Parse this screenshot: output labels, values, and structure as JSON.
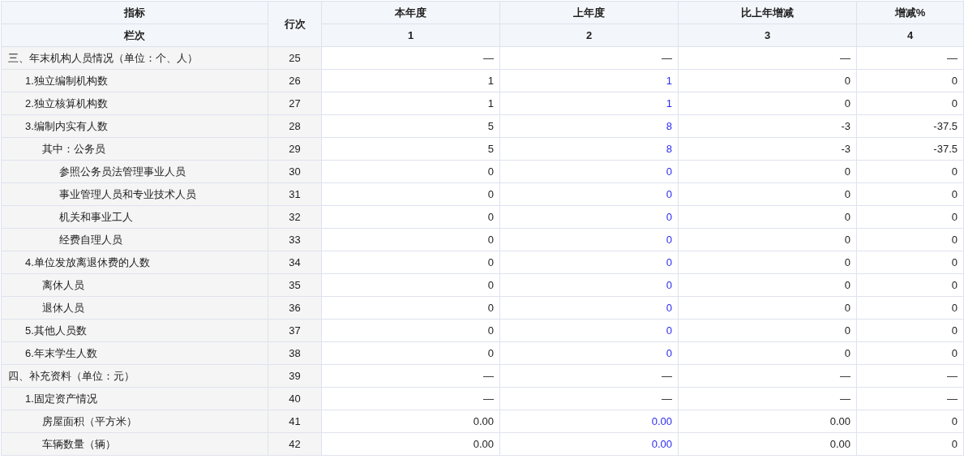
{
  "header": {
    "indicator": "指标",
    "column_label": "栏次",
    "line_no": "行次",
    "columns": [
      {
        "title": "本年度",
        "number": "1"
      },
      {
        "title": "上年度",
        "number": "2"
      },
      {
        "title": "比上年增减",
        "number": "3"
      },
      {
        "title": "增减%",
        "number": "4"
      }
    ]
  },
  "rows": [
    {
      "kind": "heading",
      "label": "三、年末机构人员情况（单位：个、人）",
      "line": "25",
      "values": [
        "—",
        "—",
        "—",
        "—"
      ],
      "children": [
        {
          "kind": "data",
          "label": "1.独立编制机构数",
          "line": "26",
          "values": [
            "1",
            "1",
            "0",
            "0"
          ]
        },
        {
          "kind": "data",
          "label": "2.独立核算机构数",
          "line": "27",
          "values": [
            "1",
            "1",
            "0",
            "0"
          ]
        },
        {
          "kind": "data",
          "label": "3.编制内实有人数",
          "line": "28",
          "values": [
            "5",
            "8",
            "-3",
            "-37.5"
          ],
          "children": [
            {
              "kind": "data",
              "label": "其中：公务员",
              "line": "29",
              "values": [
                "5",
                "8",
                "-3",
                "-37.5"
              ],
              "children": [
                {
                  "kind": "data",
                  "label": "参照公务员法管理事业人员",
                  "line": "30",
                  "values": [
                    "0",
                    "0",
                    "0",
                    "0"
                  ]
                },
                {
                  "kind": "data",
                  "label": "事业管理人员和专业技术人员",
                  "line": "31",
                  "values": [
                    "0",
                    "0",
                    "0",
                    "0"
                  ]
                },
                {
                  "kind": "data",
                  "label": "机关和事业工人",
                  "line": "32",
                  "values": [
                    "0",
                    "0",
                    "0",
                    "0"
                  ]
                },
                {
                  "kind": "data",
                  "label": "经费自理人员",
                  "line": "33",
                  "values": [
                    "0",
                    "0",
                    "0",
                    "0"
                  ]
                }
              ]
            }
          ]
        },
        {
          "kind": "data",
          "label": "4.单位发放离退休费的人数",
          "line": "34",
          "values": [
            "0",
            "0",
            "0",
            "0"
          ],
          "children": [
            {
              "kind": "data",
              "label": "离休人员",
              "line": "35",
              "values": [
                "0",
                "0",
                "0",
                "0"
              ]
            },
            {
              "kind": "data",
              "label": "退休人员",
              "line": "36",
              "values": [
                "0",
                "0",
                "0",
                "0"
              ]
            }
          ]
        },
        {
          "kind": "data",
          "label": "5.其他人员数",
          "line": "37",
          "values": [
            "0",
            "0",
            "0",
            "0"
          ]
        },
        {
          "kind": "data",
          "label": "6.年末学生人数",
          "line": "38",
          "values": [
            "0",
            "0",
            "0",
            "0"
          ]
        }
      ]
    },
    {
      "kind": "heading",
      "label": "四、补充资料（单位：元）",
      "line": "39",
      "values": [
        "—",
        "—",
        "—",
        "—"
      ],
      "children": [
        {
          "kind": "heading",
          "label": "1.固定资产情况",
          "line": "40",
          "values": [
            "—",
            "—",
            "—",
            "—"
          ],
          "children": [
            {
              "kind": "data",
              "label": "房屋面积（平方米）",
              "line": "41",
              "values": [
                "0.00",
                "0.00",
                "0.00",
                "0"
              ]
            },
            {
              "kind": "data",
              "label": "车辆数量（辆）",
              "line": "42",
              "values": [
                "0.00",
                "0.00",
                "0.00",
                "0"
              ]
            }
          ]
        }
      ]
    }
  ]
}
